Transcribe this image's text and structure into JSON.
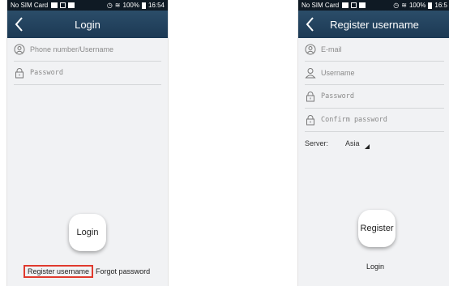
{
  "login_screen": {
    "status": {
      "carrier": "No SIM Card",
      "battery": "100%",
      "time": "16:54"
    },
    "title": "Login",
    "username_placeholder": "Phone number/Username",
    "password_placeholder": "Password",
    "login_button": "Login",
    "register_link": "Register username",
    "forgot_link": "Forgot password"
  },
  "register_screen": {
    "status": {
      "carrier": "No SIM Card",
      "battery": "100%",
      "time": "16:5"
    },
    "title": "Register username",
    "email_placeholder": "E-mail",
    "username_placeholder": "Username",
    "password_placeholder": "Password",
    "confirm_placeholder": "Confirm password",
    "server_label": "Server:",
    "server_value": "Asia",
    "register_button": "Register",
    "login_link": "Login"
  },
  "colors": {
    "appbar": "#1f3d59",
    "statusbar": "#0f1a24",
    "highlight": "#e03a2e",
    "background": "#f1f2f4"
  }
}
